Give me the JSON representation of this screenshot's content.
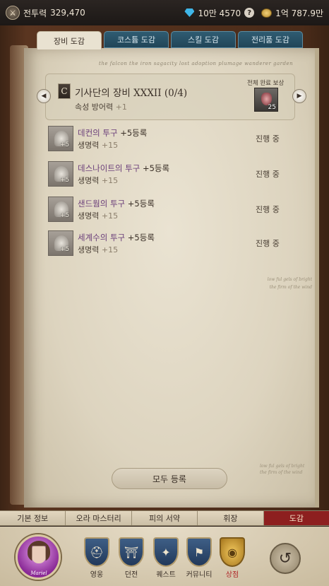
{
  "topbar": {
    "power_label": "전투력",
    "power_value": "329,470",
    "gems_value": "10만 4570",
    "help_symbol": "?",
    "gold_value": "1억 787.9만"
  },
  "tabs": [
    {
      "label": "장비 도감",
      "active": true
    },
    {
      "label": "코스튬 도감",
      "active": false
    },
    {
      "label": "스킬 도감",
      "active": false
    },
    {
      "label": "전리품 도감",
      "active": false
    }
  ],
  "page_flourish": "the falcon the iron sagacity lost adoption plumage wanderer garden",
  "set": {
    "emblem": "C",
    "title": "기사단의 장비 XXXII (0/4)",
    "stat_label": "속성 방어력",
    "stat_value": "+1",
    "reward_label": "전체 완료 보상",
    "reward_count": "25",
    "prev_symbol": "◀",
    "next_symbol": "▶"
  },
  "items": [
    {
      "name": "데컨의 투구",
      "plus": "+5",
      "suffix": "등록",
      "stat_label": "생명력",
      "stat_value": "+15",
      "status": "진행 중",
      "icon_plus": "+5"
    },
    {
      "name": "데스나이트의 투구",
      "plus": "+5",
      "suffix": "등록",
      "stat_label": "생명력",
      "stat_value": "+15",
      "status": "진행 중",
      "icon_plus": "+5"
    },
    {
      "name": "샌드웜의 투구",
      "plus": "+5",
      "suffix": "등록",
      "stat_label": "생명력",
      "stat_value": "+15",
      "status": "진행 중",
      "icon_plus": "+5"
    },
    {
      "name": "세계수의 투구",
      "plus": "+5",
      "suffix": "등록",
      "stat_label": "생명력",
      "stat_value": "+15",
      "status": "진행 중",
      "icon_plus": "+5"
    }
  ],
  "register_all_label": "모두 등록",
  "margin_notes": "low ful gels of bright the firm of the wind",
  "nav_tabs": [
    {
      "label": "기본 정보",
      "active": false
    },
    {
      "label": "오라 마스터리",
      "active": false
    },
    {
      "label": "피의 서약",
      "active": false
    },
    {
      "label": "휘장",
      "active": false
    },
    {
      "label": "도감",
      "active": true
    }
  ],
  "portrait_name": "Mariel",
  "menu": [
    {
      "label": "영웅",
      "icon": "knight-helmet-icon"
    },
    {
      "label": "던전",
      "icon": "dungeon-gate-icon"
    },
    {
      "label": "퀘스트",
      "icon": "quest-horn-icon"
    },
    {
      "label": "커뮤니티",
      "icon": "community-banner-icon"
    },
    {
      "label": "상점",
      "icon": "shop-coins-icon"
    }
  ],
  "colors": {
    "active_nav": "#8d1f1f",
    "item_name": "#6b3f7a",
    "inactive_tab": "#2f5c72",
    "page_bg": "#e6dfcc"
  }
}
